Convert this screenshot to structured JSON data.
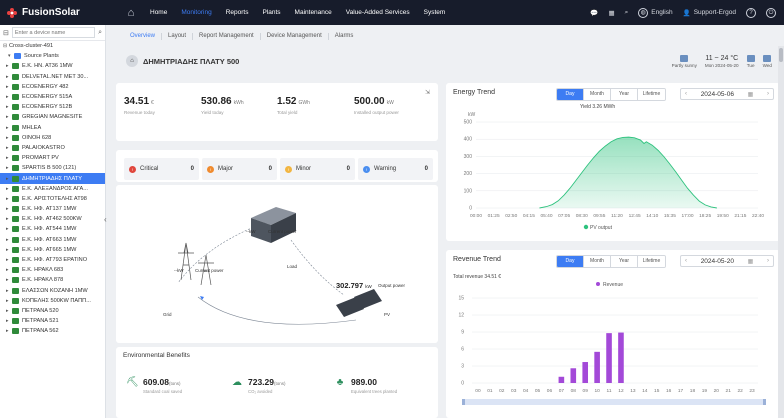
{
  "topbar": {
    "brand": "FusionSolar",
    "nav": [
      "Home",
      "Monitoring",
      "Reports",
      "Plants",
      "Maintenance",
      "Value-Added Services",
      "System"
    ],
    "active_nav": 1,
    "language": "English",
    "user": "Support-Ergod"
  },
  "sidebar": {
    "search_placeholder": "Enter a device name",
    "root": "Cross-cluster-491",
    "group": "Source Plants",
    "items": [
      "E.K. HN. AT36 1MW",
      "DELVETAL.NET MET 30...",
      "ECOENERGY 482",
      "ECOENERGY 515A",
      "ECOENERGY 512B",
      "GREGIAN MAGNESITE",
      "MHLEA",
      "OINOH 628",
      "PALAIOKASTRO",
      "PROMART PV",
      "SPARTIS B 500 (121)",
      "ΔΗΜΗΤΡΙΑΔΗΣ ΠΛΑΤΥ",
      "E.K. ΑΛΕΞΑΝΔΡΟΣ ΑΓΑ...",
      "E.K. ΑΡΙΣΤΟΤΕΛΗΣ ΑΤ98",
      "E.K. HΦ. AT137 1MW",
      "E.K. HΦ. AT462 500KW",
      "E.K. HΦ. AT544 1MW",
      "E.K. HΦ. AT663 1MW",
      "E.K. HΦ. AT665 1MW",
      "E.K. HΦ. AT793 EPATINO",
      "E.K. HPAKΛ 683",
      "E.K. HPAKΛ 878",
      "ΕΛΑΣΣΩΝ ΚΟΖΑΝΗ 1MW",
      "ΚΟΠΕΛΗΣ 500KW ΠΑΠΠ...",
      "ΠΕΤΡΑΝΑ 520",
      "ΠΕΤΡΑΝΑ 521",
      "ΠΕΤΡΑΝΑ 562"
    ],
    "selected": 11
  },
  "tabs": [
    "Overview",
    "Layout",
    "Report Management",
    "Device Management",
    "Alarms"
  ],
  "active_tab": 0,
  "plant": {
    "name": "ΔΗΜΗΤΡΙΑΔΗΣ ΠΛΑΤΥ 500"
  },
  "weather": {
    "today_label": "Partly sunny",
    "today_temp": "11 ~ 24 °C",
    "today_date": "Mon 2024-05-20",
    "tue": "Tue",
    "wed": "Wed"
  },
  "kpis": [
    {
      "value": "34.51",
      "unit": "€",
      "label": "Revenue today"
    },
    {
      "value": "530.86",
      "unit": "kWh",
      "label": "Yield today"
    },
    {
      "value": "1.52",
      "unit": "GWh",
      "label": "Total yield"
    },
    {
      "value": "500.00",
      "unit": "kW",
      "label": "Installed output power"
    }
  ],
  "alarms": [
    {
      "label": "Critical",
      "count": "0",
      "color": "#e0463c"
    },
    {
      "label": "Major",
      "count": "0",
      "color": "#f08b2f"
    },
    {
      "label": "Minor",
      "count": "0",
      "color": "#f2b541"
    },
    {
      "label": "Warning",
      "count": "0",
      "color": "#4a8ef0"
    }
  ],
  "flow": {
    "current_power_label": "Current power",
    "current_power_unit": "--kW",
    "grid_power_unit": "--kW",
    "grid_power_label": "Current power",
    "load_label": "Load",
    "pv_value": "302.797",
    "pv_unit": "kW",
    "pv_output_label": "Output power",
    "grid_label": "Grid",
    "pv_label": "PV"
  },
  "env": {
    "title": "Environmental Benefits",
    "items": [
      {
        "value": "609.08",
        "unit": "(tons)",
        "label": "Standard coal saved"
      },
      {
        "value": "723.29",
        "unit": "(tons)",
        "label": "CO₂ avoided"
      },
      {
        "value": "989.00",
        "unit": "",
        "label": "Equivalent trees planted"
      }
    ]
  },
  "energy": {
    "title": "Energy Trend",
    "segments": [
      "Day",
      "Month",
      "Year",
      "Lifetime"
    ],
    "date": "2024-05-06",
    "yield_label": "Yield 3.26 MWh"
  },
  "revenue": {
    "title": "Revenue Trend",
    "segments": [
      "Day",
      "Month",
      "Year",
      "Lifetime"
    ],
    "date": "2024-05-20",
    "total_label": "Total revenue 34.51 €"
  },
  "chart_data": [
    {
      "type": "area",
      "ylabel": "kW",
      "ylim": [
        0,
        500
      ],
      "yticks": [
        0,
        100,
        200,
        300,
        400,
        500
      ],
      "xticks": [
        "00:00",
        "01:25",
        "02:50",
        "04:15",
        "05:40",
        "07:05",
        "08:30",
        "09:55",
        "11:20",
        "12:45",
        "14:10",
        "15:35",
        "17:00",
        "18:25",
        "19:50",
        "21:15",
        "22:40"
      ],
      "series": [
        {
          "name": "PV output",
          "color": "#2ec27e",
          "x": [
            5.4,
            6.0,
            6.5,
            7.0,
            7.5,
            8.0,
            8.5,
            9.0,
            9.5,
            10.0,
            10.5,
            11.0,
            11.5,
            12.0,
            12.5,
            13.0,
            13.5,
            14.0,
            14.3,
            14.5,
            15.0,
            15.5,
            16.0,
            16.5,
            17.0,
            17.5,
            18.0,
            18.5,
            19.0,
            19.5,
            20.0,
            20.5
          ],
          "values": [
            0,
            8,
            20,
            42,
            75,
            115,
            160,
            205,
            250,
            292,
            330,
            360,
            385,
            402,
            410,
            412,
            408,
            395,
            375,
            385,
            365,
            335,
            298,
            255,
            210,
            162,
            115,
            75,
            40,
            18,
            6,
            0
          ]
        }
      ],
      "grid": true,
      "legend": "bottom-center"
    },
    {
      "type": "bar",
      "ylim": [
        0,
        15
      ],
      "yticks": [
        0,
        3,
        6,
        9,
        12,
        15
      ],
      "categories": [
        "00",
        "01",
        "02",
        "03",
        "04",
        "05",
        "06",
        "07",
        "08",
        "09",
        "10",
        "11",
        "12",
        "13",
        "14",
        "15",
        "16",
        "17",
        "18",
        "19",
        "20",
        "21",
        "22",
        "23"
      ],
      "series": [
        {
          "name": "Revenue",
          "color": "#a349d8",
          "values": [
            0,
            0,
            0,
            0,
            0,
            0,
            0,
            1.1,
            2.6,
            3.7,
            5.5,
            8.8,
            8.9,
            0,
            0,
            0,
            0,
            0,
            0,
            0,
            0,
            0,
            0,
            0
          ]
        }
      ],
      "grid": true,
      "legend": "top-center"
    }
  ]
}
